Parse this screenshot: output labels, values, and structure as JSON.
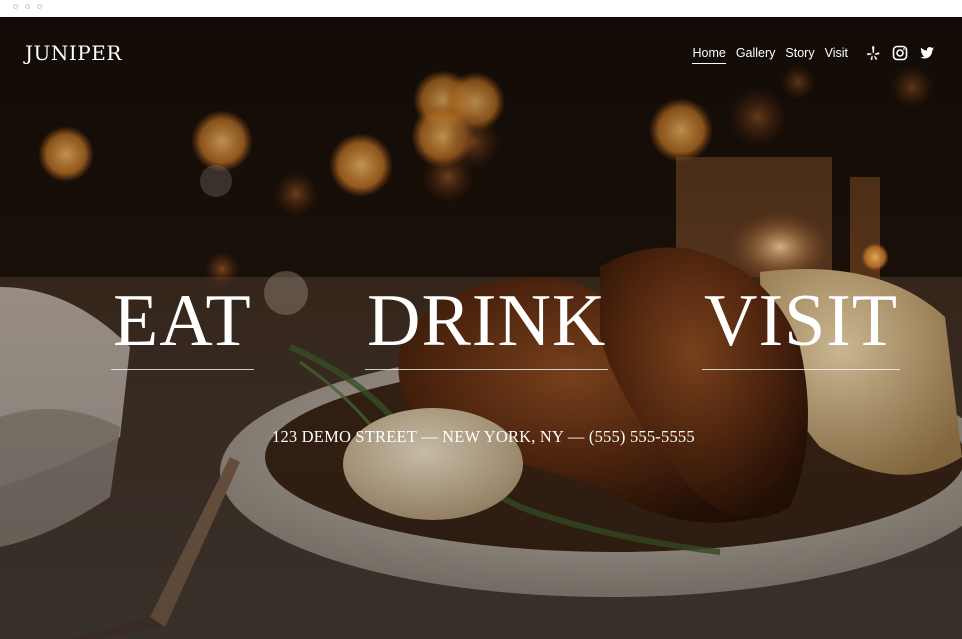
{
  "brand": {
    "name": "JUNIPER"
  },
  "nav": {
    "items": [
      {
        "label": "Home",
        "active": true
      },
      {
        "label": "Gallery",
        "active": false
      },
      {
        "label": "Story",
        "active": false
      },
      {
        "label": "Visit",
        "active": false
      }
    ]
  },
  "social": {
    "icons": [
      "yelp-icon",
      "instagram-icon",
      "twitter-icon"
    ]
  },
  "hero": {
    "headings": [
      "EAT",
      "DRINK",
      "VISIT"
    ],
    "address": "123 DEMO STREET — NEW YORK, NY — (555) 555-5555"
  },
  "colors": {
    "text": "#ffffff",
    "background_dark": "#1a0f08",
    "bokeh": "#f2a04a"
  }
}
